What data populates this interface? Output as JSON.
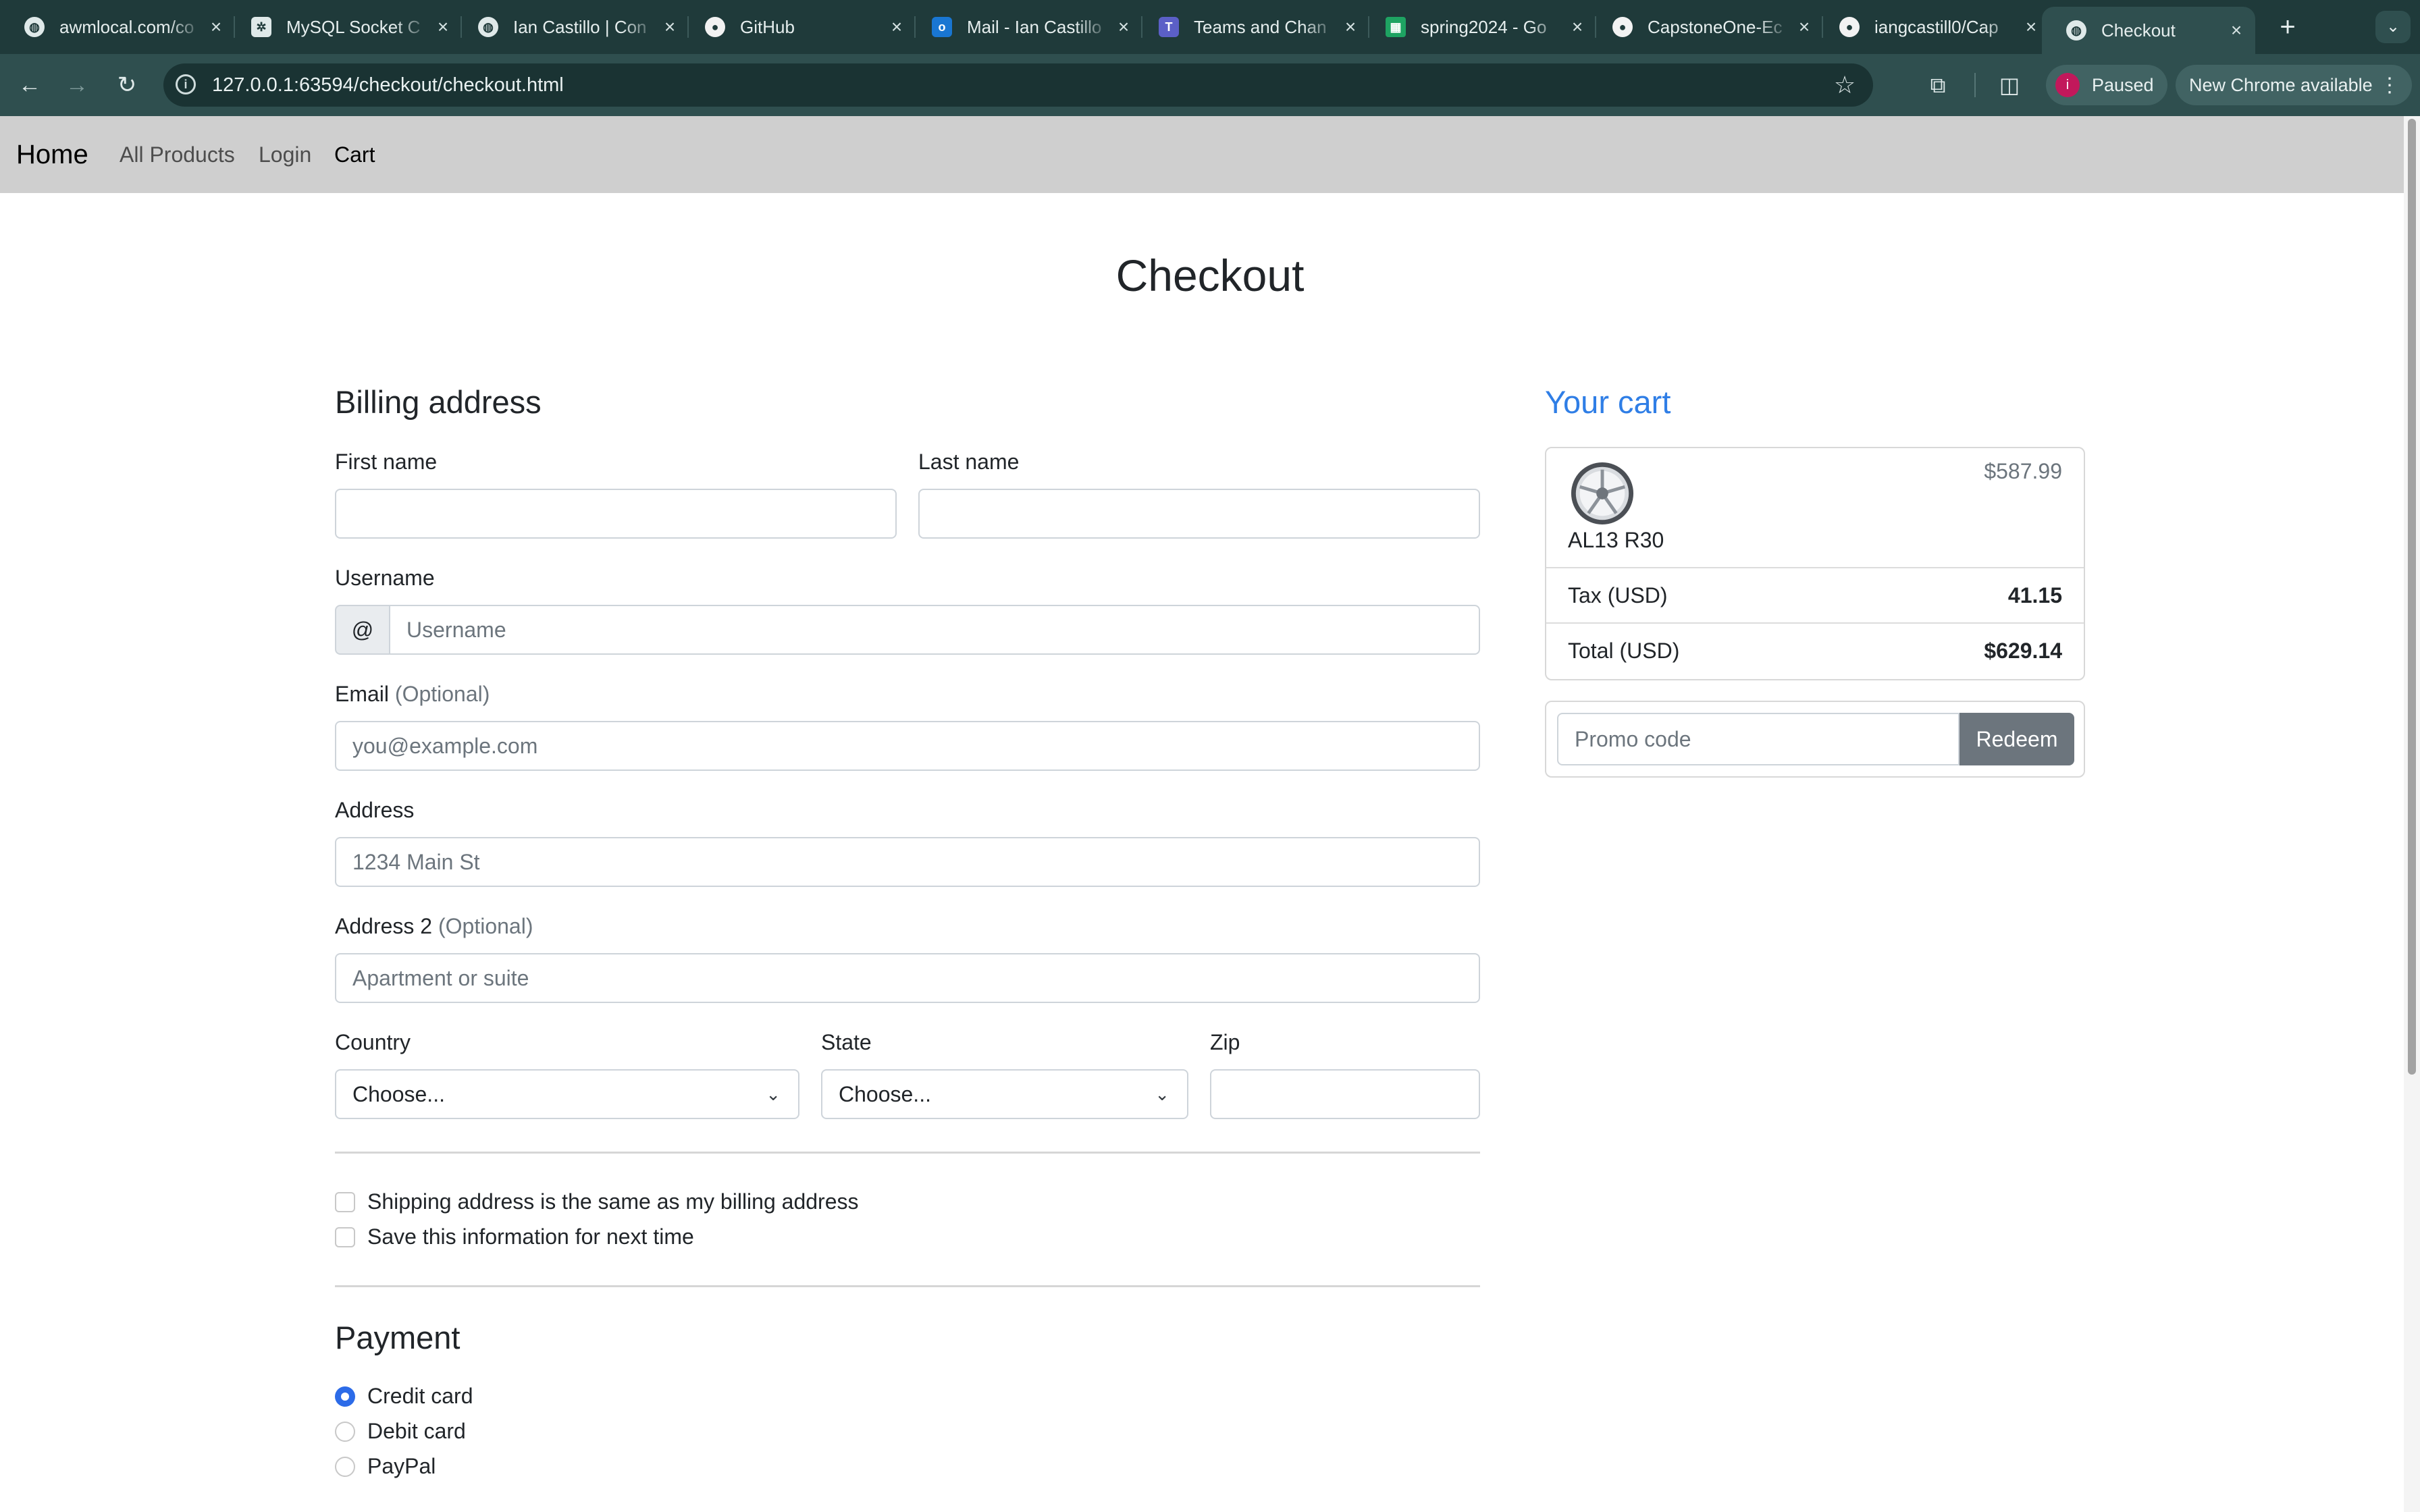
{
  "browser": {
    "tabs": [
      {
        "title": "awmlocal.com/co",
        "icon": "globe-icon"
      },
      {
        "title": "MySQL Socket C",
        "icon": "chatgpt-icon"
      },
      {
        "title": "Ian Castillo | Con",
        "icon": "globe-icon"
      },
      {
        "title": "GitHub",
        "icon": "github-icon"
      },
      {
        "title": "Mail - Ian Castillo",
        "icon": "outlook-icon"
      },
      {
        "title": "Teams and Chan",
        "icon": "teams-icon"
      },
      {
        "title": "spring2024 - Go",
        "icon": "sheets-icon"
      },
      {
        "title": "CapstoneOne-Ec",
        "icon": "github-icon"
      },
      {
        "title": "iangcastill0/Cap",
        "icon": "github-icon"
      },
      {
        "title": "Checkout",
        "icon": "globe-icon"
      }
    ],
    "url": "127.0.0.1:63594/checkout/checkout.html",
    "profile_initial": "i",
    "profile_status": "Paused",
    "update_label": "New Chrome available"
  },
  "nav": {
    "brand": "Home",
    "links": [
      "All Products",
      "Login",
      "Cart"
    ]
  },
  "page": {
    "title": "Checkout"
  },
  "billing": {
    "heading": "Billing address",
    "first_name_label": "First name",
    "first_name_value": "",
    "last_name_label": "Last name",
    "last_name_value": "",
    "username_label": "Username",
    "username_prefix": "@",
    "username_placeholder": "Username",
    "email_label": "Email",
    "email_optional": "(Optional)",
    "email_placeholder": "you@example.com",
    "address_label": "Address",
    "address_placeholder": "1234 Main St",
    "address2_label": "Address 2",
    "address2_optional": "(Optional)",
    "address2_placeholder": "Apartment or suite",
    "country_label": "Country",
    "country_value": "Choose...",
    "state_label": "State",
    "state_value": "Choose...",
    "zip_label": "Zip",
    "zip_value": "",
    "same_address_label": "Shipping address is the same as my billing address",
    "save_info_label": "Save this information for next time"
  },
  "payment": {
    "heading": "Payment",
    "options": [
      "Credit card",
      "Debit card",
      "PayPal"
    ],
    "selected": "Credit card"
  },
  "cart": {
    "heading": "Your cart",
    "item_name": "AL13 R30",
    "item_price": "$587.99",
    "item_image": "wheel-image",
    "tax_label": "Tax (USD)",
    "tax_value": "41.15",
    "total_label": "Total (USD)",
    "total_value": "$629.14",
    "promo_placeholder": "Promo code",
    "redeem_label": "Redeem"
  }
}
